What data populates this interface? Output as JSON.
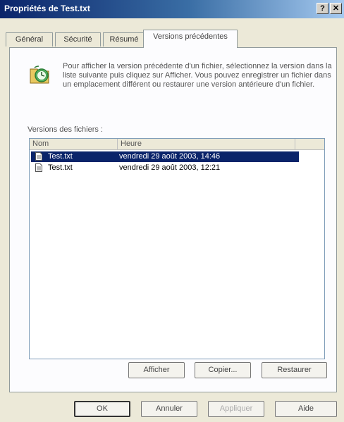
{
  "window": {
    "title": "Propriétés de Test.txt"
  },
  "titlebar_buttons": {
    "help": "?",
    "close": "✕"
  },
  "tabs": [
    {
      "label": "Général"
    },
    {
      "label": "Sécurité"
    },
    {
      "label": "Résumé"
    },
    {
      "label": "Versions précédentes"
    }
  ],
  "info": {
    "text": "Pour afficher la version précédente d'un fichier, sélectionnez la version dans la liste suivante puis cliquez sur Afficher. Vous pouvez enregistrer un fichier dans un emplacement différent ou restaurer une version antérieure d'un fichier.",
    "icon": "clock-folder-icon"
  },
  "versions": {
    "label": "Versions des fichiers :",
    "columns": [
      "Nom",
      "Heure"
    ],
    "rows": [
      {
        "name": "Test.txt",
        "time": "vendredi 29 août 2003, 14:46",
        "selected": true
      },
      {
        "name": "Test.txt",
        "time": "vendredi 29 août 2003, 12:21",
        "selected": false
      }
    ]
  },
  "panel_buttons": {
    "view": "Afficher",
    "copy": "Copier...",
    "restore": "Restaurer"
  },
  "dialog_buttons": {
    "ok": "OK",
    "cancel": "Annuler",
    "apply": "Appliquer",
    "help": "Aide"
  },
  "colors": {
    "selection": "#0a246a",
    "title_start": "#0a246a",
    "title_end": "#a6caf0"
  }
}
